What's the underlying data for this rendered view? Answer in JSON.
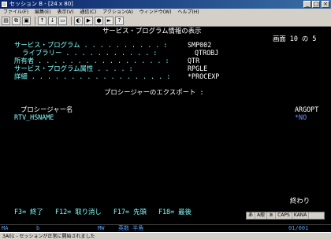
{
  "window": {
    "title": "セッション B - [24 x 80]",
    "min_label": "_",
    "max_label": "□",
    "close_label": "×"
  },
  "menu": [
    "ファイル(F)",
    "編集(E)",
    "表示(V)",
    "通信(C)",
    "アクション(A)",
    "ウィンドウ(W)",
    "ヘルプ(H)"
  ],
  "toolbar_icons": [
    "print-icon",
    "copy-icon",
    "paste-icon",
    "send-icon",
    "receive-icon",
    "display-icon",
    "color-icon",
    "macro-icon",
    "record-icon",
    "play-icon",
    "help-icon"
  ],
  "screen": {
    "title": "サービス・プログラム情報の表示",
    "page_indicator": "画面 10 の 5",
    "fields": [
      {
        "label": "サービス・プログラム . . . . . . . . . . :",
        "value": "SMP002"
      },
      {
        "label": "  ライブラリー . . . . . . . . . . . :",
        "value": "QTROBJ"
      },
      {
        "label": "所有者 . . . . . . . . . . . . . . . . :",
        "value": "QTR"
      },
      {
        "label": "サービス・プログラム属性 . . . . :",
        "value": "RPGLE"
      },
      {
        "label": "詳細 . . . . . . . . . . . . . . . . . :",
        "value": "*PROCEXP"
      }
    ],
    "section_title": "プロシージャーのエクスポート :",
    "column_header_name": "プロシージャー名",
    "column_header_argopt": "ARGOPT",
    "rows": [
      {
        "name": "RTV_HSNAME",
        "argopt": "*NO"
      }
    ],
    "bottom_status": "終わり",
    "function_keys": "F3= 終了   F12= 取り消し   F17= 先頭   F18= 最後"
  },
  "ime_toolbar": [
    "あ",
    "A般",
    "ぁ",
    "CAPS",
    "KANA"
  ],
  "oia": {
    "left": "MA",
    "indicator_b": "b",
    "mw": "MW",
    "ime_mode": "英数 半角",
    "cursor_pos": "01/001"
  },
  "statusbar": {
    "text": "3A01 - セッションが正常に開始されました"
  },
  "colors": {
    "screen_bg": "#000000",
    "field_color": "#7fffff",
    "value_color": "#ffffff",
    "title_gradient_start": "#0a246a"
  }
}
